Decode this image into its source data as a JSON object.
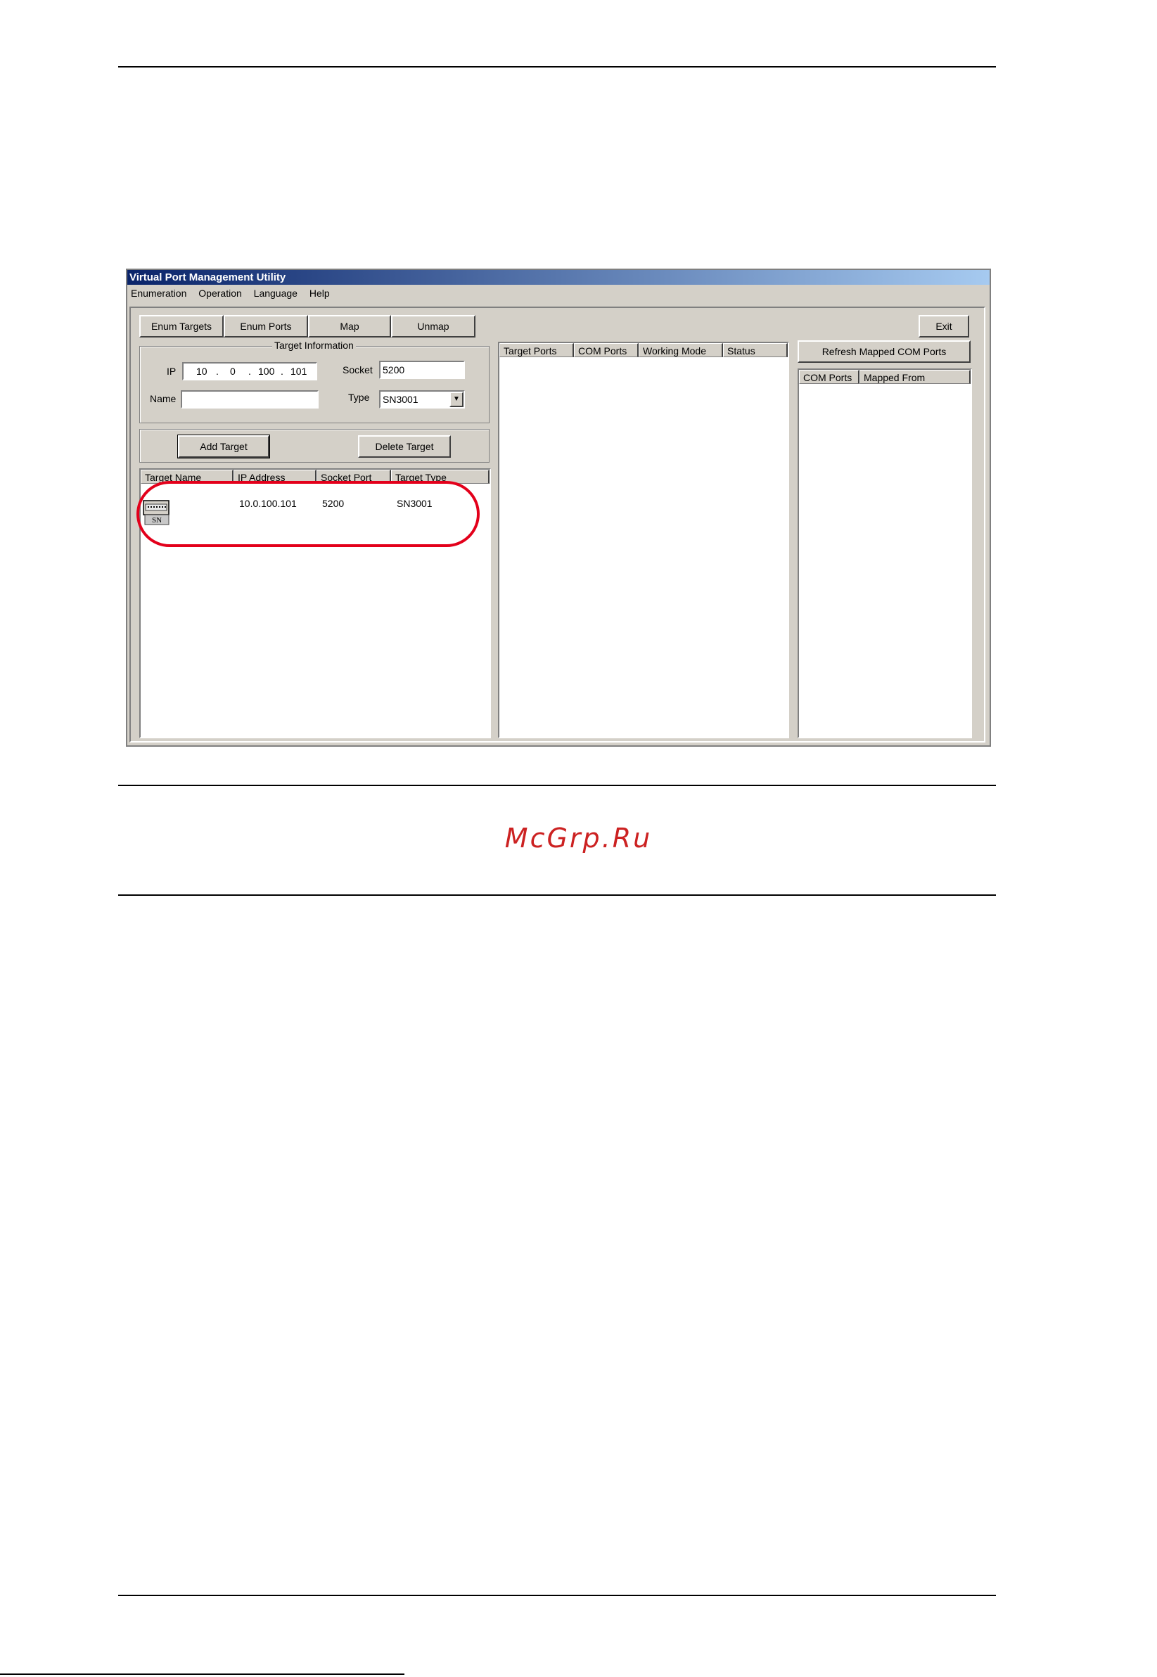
{
  "window": {
    "title": "Virtual Port Management Utility"
  },
  "menu": [
    "Enumeration",
    "Operation",
    "Language",
    "Help"
  ],
  "toolbar": {
    "enum_targets": "Enum Targets",
    "enum_ports": "Enum Ports",
    "map": "Map",
    "unmap": "Unmap",
    "exit": "Exit"
  },
  "target_info": {
    "group_title": "Target Information",
    "ip_label": "IP",
    "ip": [
      "10",
      "0",
      "100",
      "101"
    ],
    "ip_separator": ".",
    "socket_label": "Socket",
    "socket": "5200",
    "name_label": "Name",
    "name": "",
    "type_label": "Type",
    "type": "SN3001"
  },
  "actions": {
    "add_target": "Add Target",
    "delete_target": "Delete Target"
  },
  "targets_table": {
    "columns": [
      "Target Name",
      "IP Address",
      "Socket Port",
      "Target Type"
    ],
    "rows": [
      {
        "icon_text": "SN",
        "ip": "10.0.100.101",
        "socket": "5200",
        "type": "SN3001"
      }
    ]
  },
  "ports_table": {
    "columns": [
      "Target Ports",
      "COM Ports",
      "Working Mode",
      "Status"
    ]
  },
  "mapped": {
    "refresh": "Refresh Mapped COM Ports",
    "columns": [
      "COM Ports",
      "Mapped From"
    ]
  },
  "watermark": "McGrp.Ru",
  "colors": {
    "highlight": "#e3001b",
    "watermark": "#cc2222",
    "titlebar_start": "#0a246a",
    "titlebar_end": "#a6caf0"
  }
}
